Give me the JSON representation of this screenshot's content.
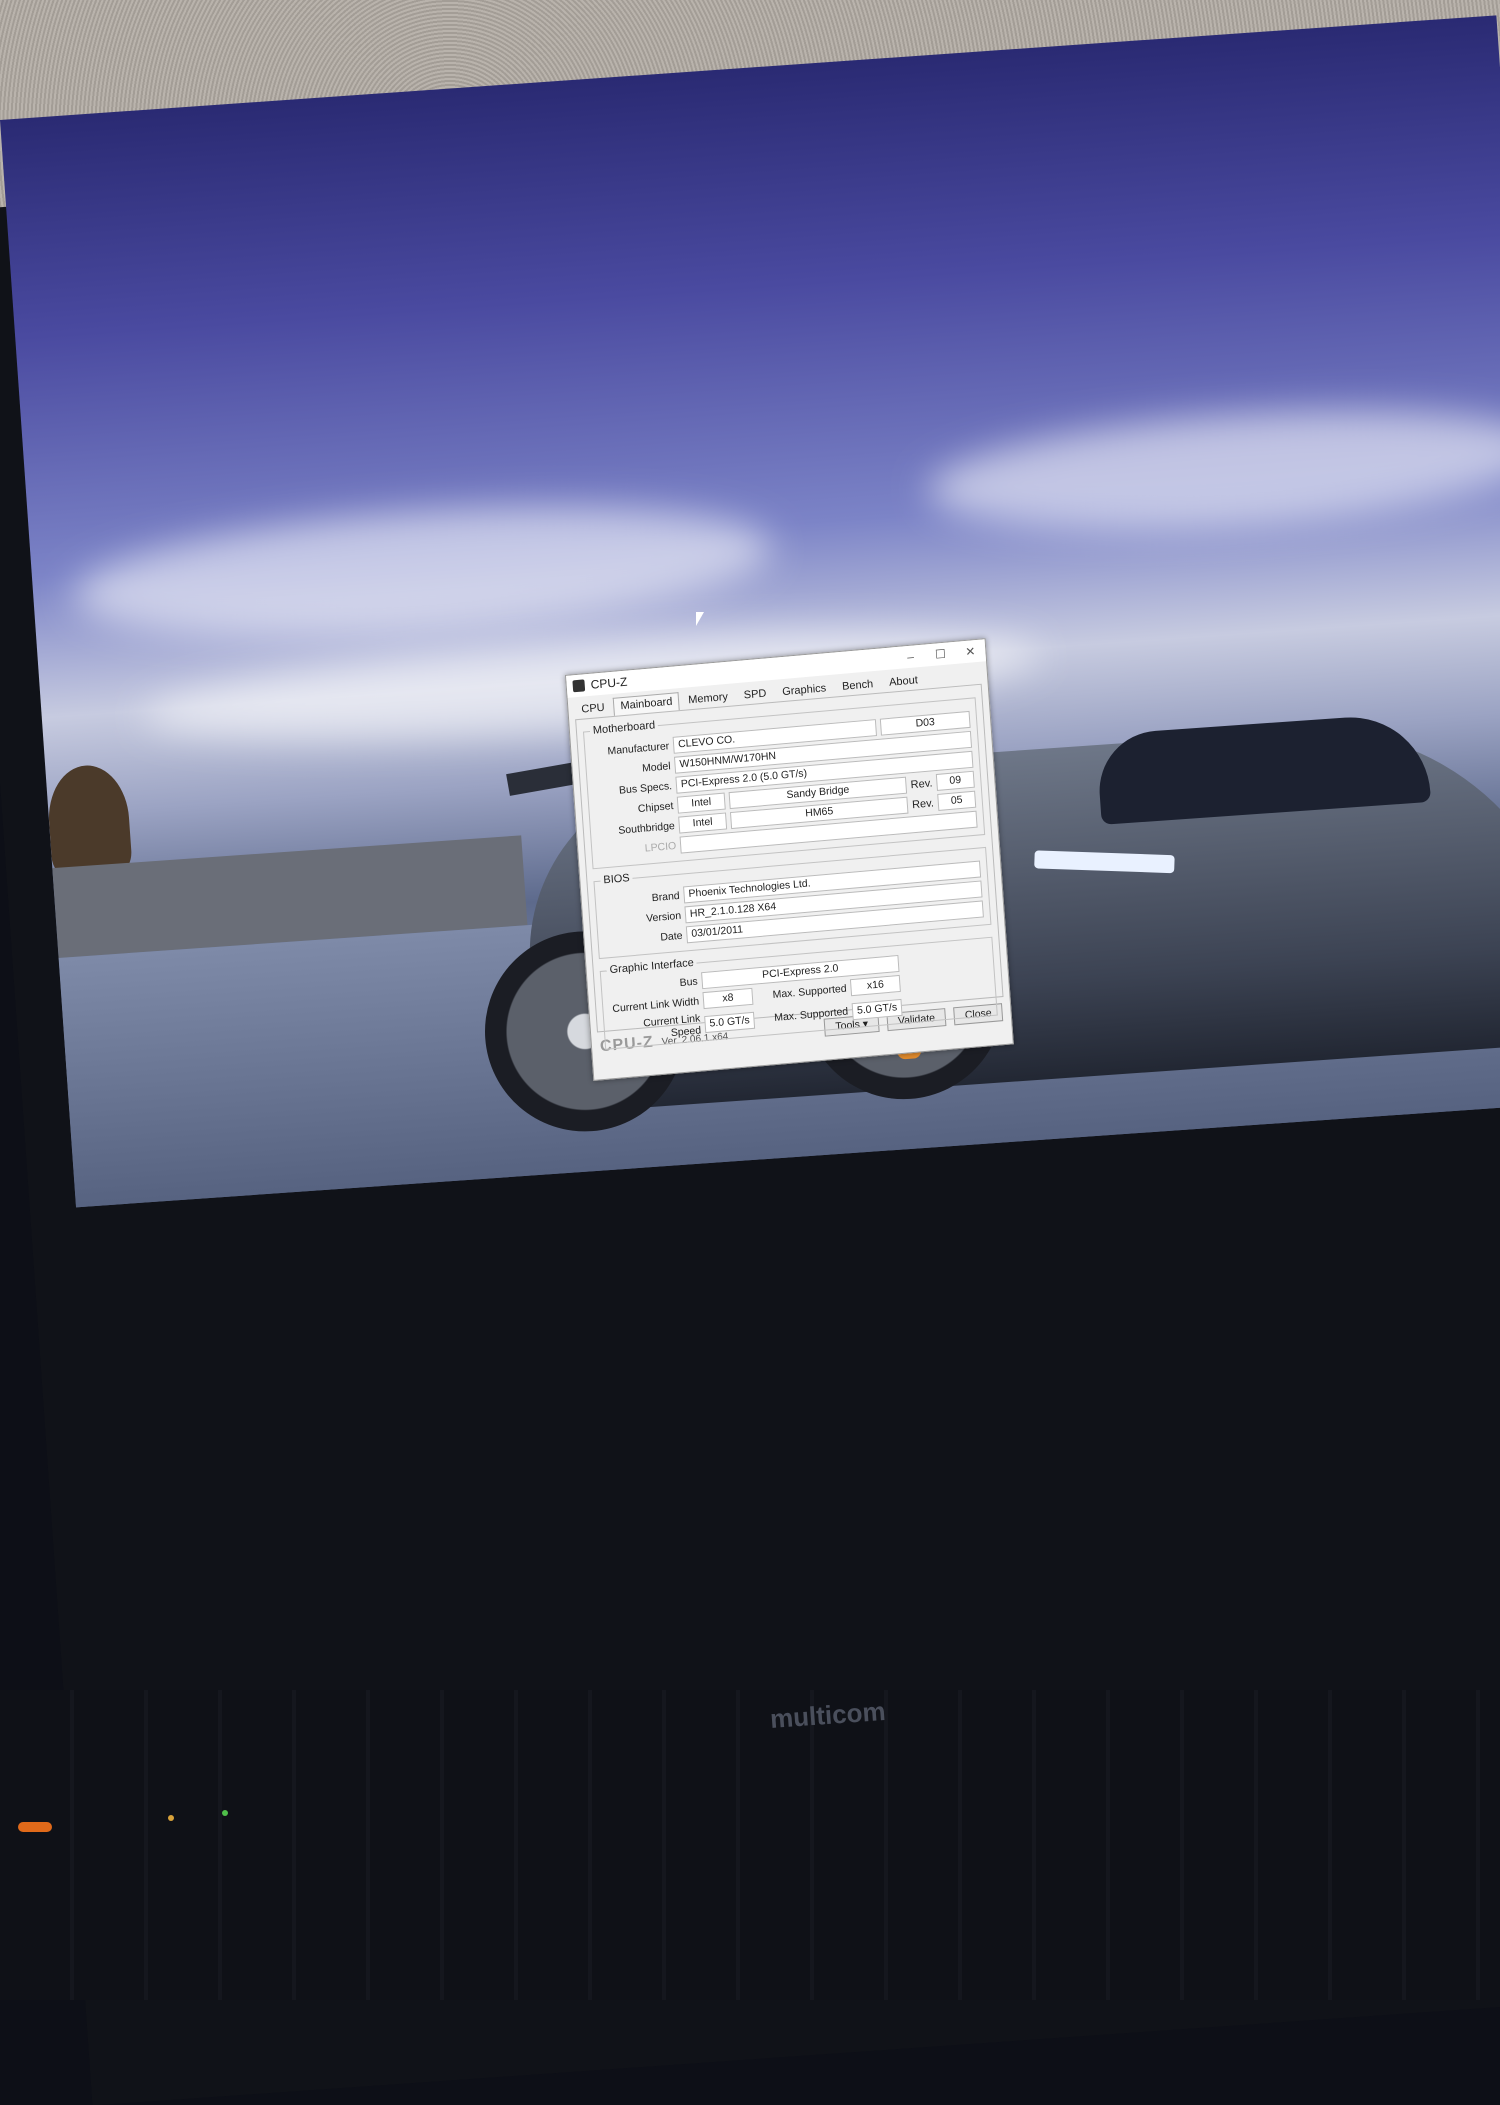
{
  "window": {
    "title": "CPU-Z",
    "minimize_label": "–",
    "maximize_label": "☐",
    "close_label": "✕"
  },
  "tabs": [
    "CPU",
    "Mainboard",
    "Memory",
    "SPD",
    "Graphics",
    "Bench",
    "About"
  ],
  "active_tab": "Mainboard",
  "motherboard": {
    "legend": "Motherboard",
    "manufacturer_label": "Manufacturer",
    "manufacturer": "CLEVO CO.",
    "manufacturer_extra": "D03",
    "model_label": "Model",
    "model": "W150HNM/W170HN",
    "bus_specs_label": "Bus Specs.",
    "bus_specs": "PCI-Express 2.0 (5.0 GT/s)",
    "chipset_label": "Chipset",
    "chipset_vendor": "Intel",
    "chipset_name": "Sandy Bridge",
    "chipset_rev_label": "Rev.",
    "chipset_rev": "09",
    "southbridge_label": "Southbridge",
    "southbridge_vendor": "Intel",
    "southbridge_name": "HM65",
    "southbridge_rev_label": "Rev.",
    "southbridge_rev": "05",
    "lpcio_label": "LPCIO"
  },
  "bios": {
    "legend": "BIOS",
    "brand_label": "Brand",
    "brand": "Phoenix Technologies Ltd.",
    "version_label": "Version",
    "version": "HR_2.1.0.128 X64",
    "date_label": "Date",
    "date": "03/01/2011"
  },
  "graphic_interface": {
    "legend": "Graphic Interface",
    "bus_label": "Bus",
    "bus": "PCI-Express 2.0",
    "link_width_label": "Current Link Width",
    "link_width": "x8",
    "max_width_label": "Max. Supported",
    "max_width": "x16",
    "link_speed_label": "Current Link Speed",
    "link_speed": "5.0 GT/s",
    "max_speed_label": "Max. Supported",
    "max_speed": "5.0 GT/s"
  },
  "footer": {
    "brand": "CPU-Z",
    "version": "Ver. 2.06.1.x64",
    "tools_label": "Tools",
    "validate_label": "Validate",
    "close_label": "Close"
  },
  "laptop": {
    "brand": "multicom"
  },
  "taskbar_icons": [
    "windows-icon",
    "opera-icon",
    "folder-icon",
    "cpuz-task-icon"
  ]
}
